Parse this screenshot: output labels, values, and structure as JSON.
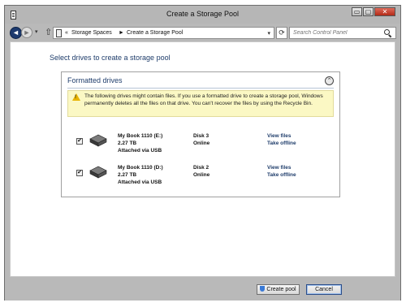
{
  "window": {
    "title": "Create a Storage Pool"
  },
  "titlebar": {
    "minimize_glyph": "▭",
    "maximize_glyph": "▢",
    "close_glyph": "✕"
  },
  "nav": {
    "back_glyph": "◄",
    "forward_glyph": "►",
    "history_glyph": "▾",
    "up_glyph": "⇧",
    "breadcrumb_separator": "«",
    "breadcrumbs": [
      "Storage Spaces",
      "Create a Storage Pool"
    ],
    "crumb_arrow": "►",
    "address_dropdown_glyph": "▾",
    "refresh_glyph": "⟳",
    "search_placeholder": "Search Control Panel"
  },
  "main": {
    "page_title": "Select drives to create a storage pool",
    "section": {
      "title": "Formatted drives",
      "collapse_glyph": "⌃",
      "warning_icon": "!",
      "warning": "The following drives might contain files. If you use a formatted drive to create a storage pool, Windows permanently deletes all the files on that drive. You can't recover the files by using the Recycle Bin."
    },
    "drives": [
      {
        "checked": true,
        "check_glyph": "✔",
        "name": "My Book 1110 (E:)",
        "size": "2.27 TB",
        "connection": "Attached via USB",
        "disk": "Disk 3",
        "status": "Online",
        "link_view": "View files",
        "link_offline": "Take offline"
      },
      {
        "checked": true,
        "check_glyph": "✔",
        "name": "My Book 1110 (D:)",
        "size": "2.27 TB",
        "connection": "Attached via USB",
        "disk": "Disk 2",
        "status": "Online",
        "link_view": "View files",
        "link_offline": "Take offline"
      }
    ]
  },
  "footer": {
    "create_label": "Create pool",
    "cancel_label": "Cancel"
  },
  "colors": {
    "accent": "#1f3d6b",
    "warning_bg": "#fbf8c4",
    "chrome": "#b9b9b9"
  },
  "icons": [
    "control-panel-icon",
    "back-arrow-icon",
    "forward-arrow-icon",
    "up-arrow-icon",
    "refresh-icon",
    "search-icon",
    "collapse-icon",
    "warning-icon",
    "external-drive-icon",
    "uac-shield-icon"
  ]
}
